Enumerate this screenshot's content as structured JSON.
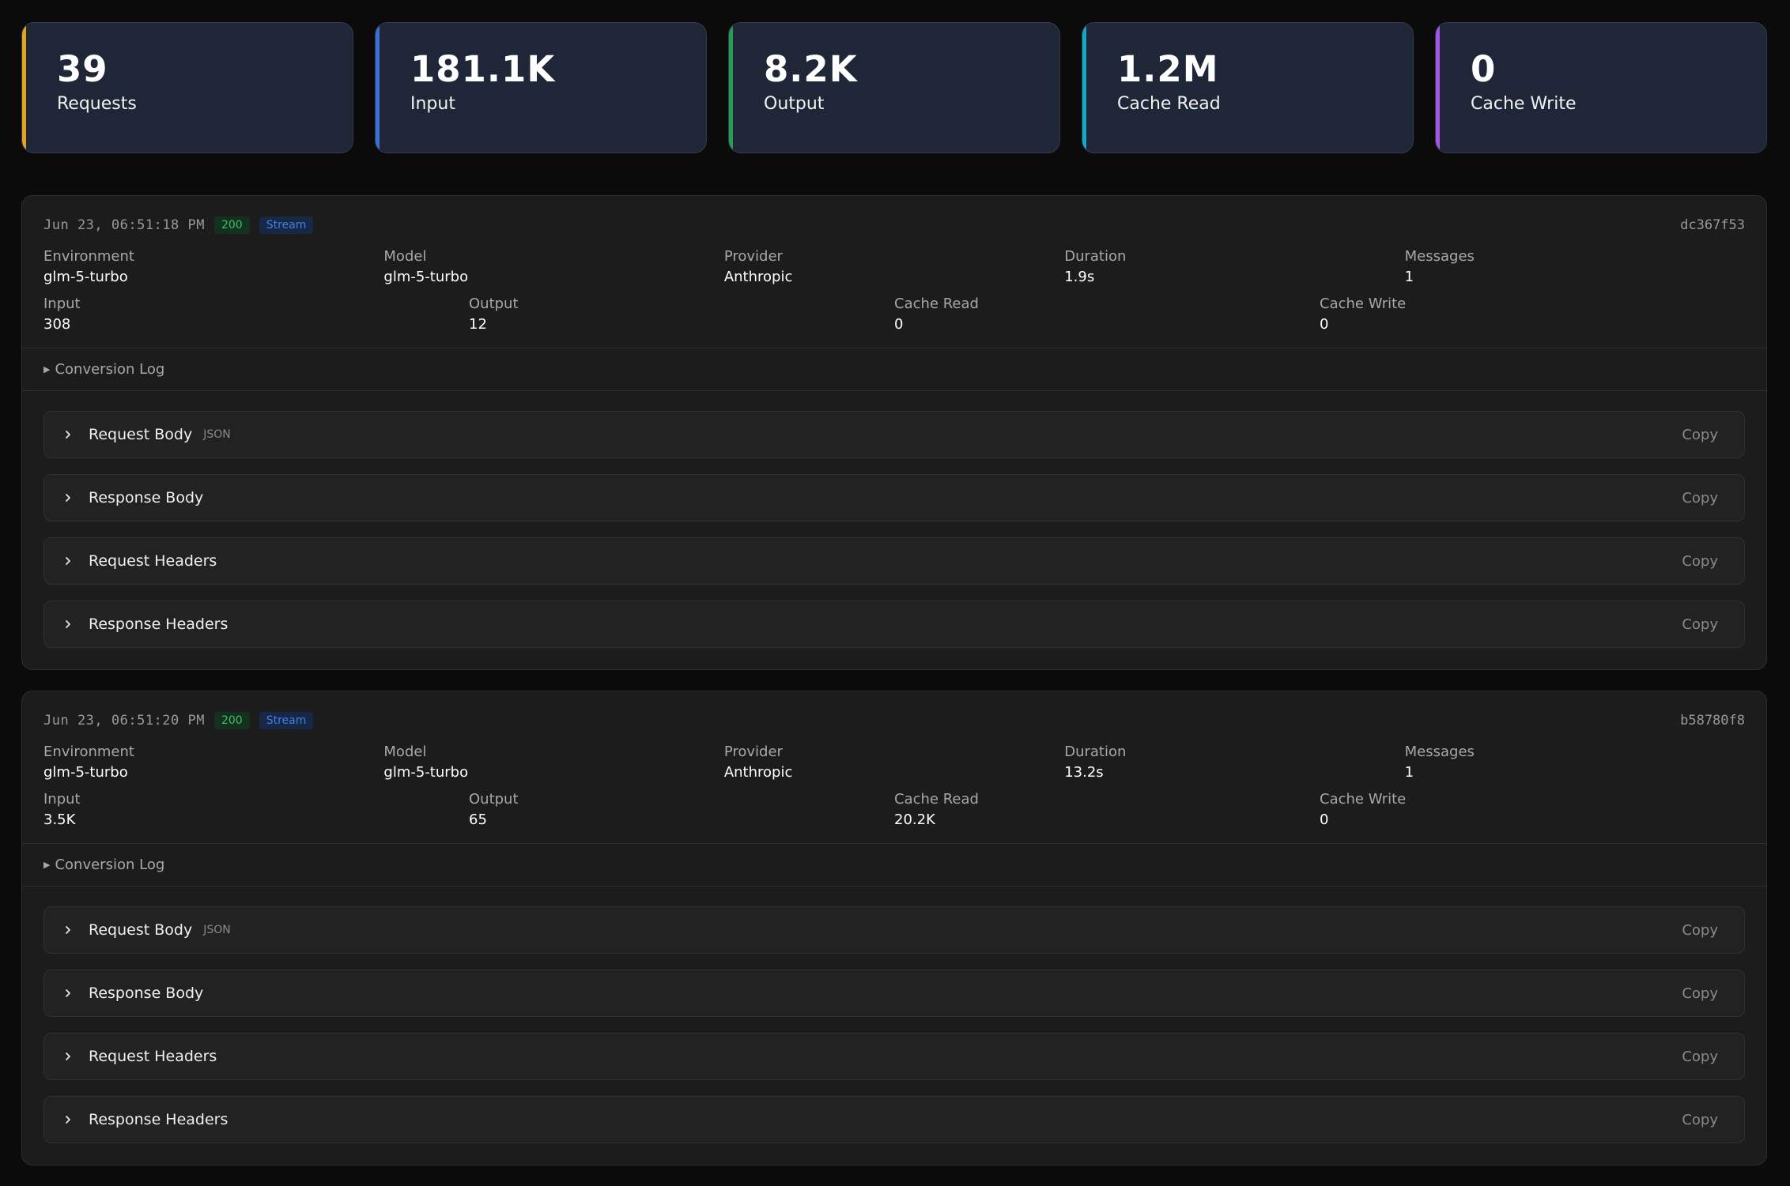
{
  "stats": [
    {
      "value": "39",
      "label": "Requests",
      "accent": "#e6a321"
    },
    {
      "value": "181.1K",
      "label": "Input",
      "accent": "#3b6fd4"
    },
    {
      "value": "8.2K",
      "label": "Output",
      "accent": "#23a04f"
    },
    {
      "value": "1.2M",
      "label": "Cache Read",
      "accent": "#16a9c4"
    },
    {
      "value": "0",
      "label": "Cache Write",
      "accent": "#a455e6"
    }
  ],
  "entries": [
    {
      "timestamp": "Jun 23, 06:51:18 PM",
      "status": "200",
      "stream_label": "Stream",
      "id": "dc367f53",
      "fields": {
        "environment": {
          "label": "Environment",
          "value": "glm-5-turbo"
        },
        "model": {
          "label": "Model",
          "value": "glm-5-turbo"
        },
        "provider": {
          "label": "Provider",
          "value": "Anthropic"
        },
        "duration": {
          "label": "Duration",
          "value": "1.9s"
        },
        "messages": {
          "label": "Messages",
          "value": "1"
        },
        "input": {
          "label": "Input",
          "value": "308"
        },
        "output": {
          "label": "Output",
          "value": "12"
        },
        "cache_read": {
          "label": "Cache Read",
          "value": "0"
        },
        "cache_write": {
          "label": "Cache Write",
          "value": "0"
        }
      },
      "conversion_log": "Conversion Log",
      "sections": [
        {
          "title": "Request Body",
          "tag": "JSON",
          "copy": "Copy"
        },
        {
          "title": "Response Body",
          "tag": "",
          "copy": "Copy"
        },
        {
          "title": "Request Headers",
          "tag": "",
          "copy": "Copy"
        },
        {
          "title": "Response Headers",
          "tag": "",
          "copy": "Copy"
        }
      ]
    },
    {
      "timestamp": "Jun 23, 06:51:20 PM",
      "status": "200",
      "stream_label": "Stream",
      "id": "b58780f8",
      "fields": {
        "environment": {
          "label": "Environment",
          "value": "glm-5-turbo"
        },
        "model": {
          "label": "Model",
          "value": "glm-5-turbo"
        },
        "provider": {
          "label": "Provider",
          "value": "Anthropic"
        },
        "duration": {
          "label": "Duration",
          "value": "13.2s"
        },
        "messages": {
          "label": "Messages",
          "value": "1"
        },
        "input": {
          "label": "Input",
          "value": "3.5K"
        },
        "output": {
          "label": "Output",
          "value": "65"
        },
        "cache_read": {
          "label": "Cache Read",
          "value": "20.2K"
        },
        "cache_write": {
          "label": "Cache Write",
          "value": "0"
        }
      },
      "conversion_log": "Conversion Log",
      "sections": [
        {
          "title": "Request Body",
          "tag": "JSON",
          "copy": "Copy"
        },
        {
          "title": "Response Body",
          "tag": "",
          "copy": "Copy"
        },
        {
          "title": "Request Headers",
          "tag": "",
          "copy": "Copy"
        },
        {
          "title": "Response Headers",
          "tag": "",
          "copy": "Copy"
        }
      ]
    }
  ]
}
